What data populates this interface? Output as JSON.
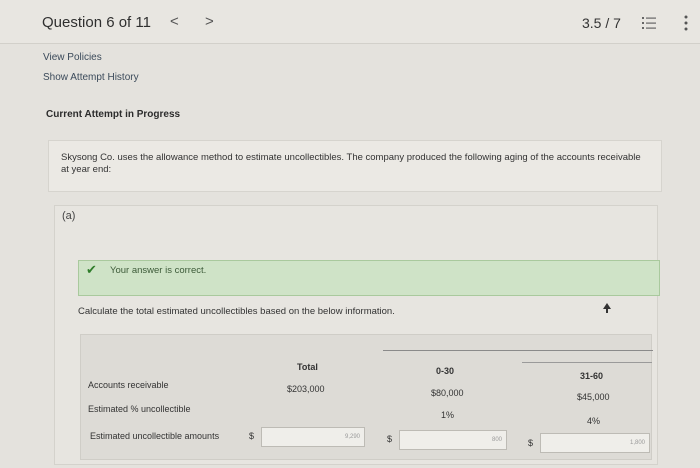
{
  "header": {
    "question_label": "Question 6 of 11",
    "prev_glyph": "<",
    "next_glyph": ">",
    "score": "3.5 / 7"
  },
  "links": {
    "view_policies": "View Policies",
    "show_attempt_history": "Show Attempt History"
  },
  "attempt": {
    "heading": "Current Attempt in Progress"
  },
  "problem": {
    "text": "Skysong Co. uses the allowance method to estimate uncollectibles. The company produced the following aging of the accounts receivable at year end:"
  },
  "part": {
    "label": "(a)",
    "feedback": "Your answer is correct.",
    "instruction": "Calculate the total estimated uncollectibles based on the below information."
  },
  "table": {
    "columns": [
      "Total",
      "0-30",
      "31-60"
    ],
    "rows": {
      "accounts_receivable": {
        "label": "Accounts receivable",
        "total": "$203,000",
        "c0_30": "$80,000",
        "c31_60": "$45,000"
      },
      "pct_uncollectible": {
        "label": "Estimated % uncollectible",
        "c0_30": "1%",
        "c31_60": "4%"
      },
      "est_amounts": {
        "label": "Estimated uncollectible amounts",
        "currency": "$",
        "total_value": "9,290",
        "c0_30_value": "800",
        "c31_60_value": "1,800"
      }
    }
  },
  "colors": {
    "background": "#e4e2dd",
    "success_bg": "#cfe3c7",
    "success_check": "#2f7d2a"
  }
}
